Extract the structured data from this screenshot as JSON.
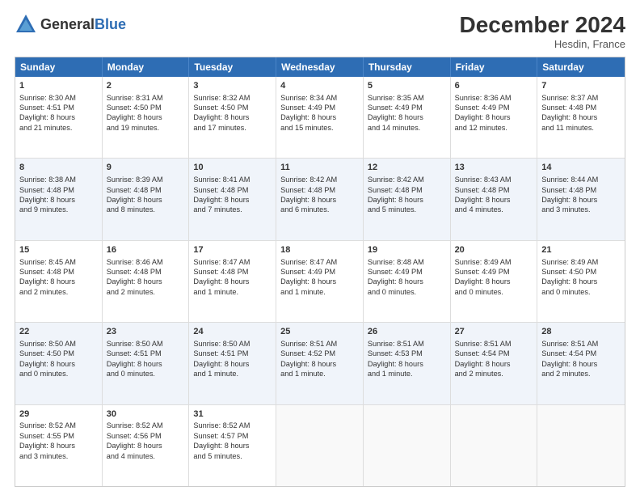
{
  "header": {
    "logo_general": "General",
    "logo_blue": "Blue",
    "title": "December 2024",
    "location": "Hesdin, France"
  },
  "days_of_week": [
    "Sunday",
    "Monday",
    "Tuesday",
    "Wednesday",
    "Thursday",
    "Friday",
    "Saturday"
  ],
  "rows": [
    [
      {
        "day": "1",
        "lines": [
          "Sunrise: 8:30 AM",
          "Sunset: 4:51 PM",
          "Daylight: 8 hours",
          "and 21 minutes."
        ]
      },
      {
        "day": "2",
        "lines": [
          "Sunrise: 8:31 AM",
          "Sunset: 4:50 PM",
          "Daylight: 8 hours",
          "and 19 minutes."
        ]
      },
      {
        "day": "3",
        "lines": [
          "Sunrise: 8:32 AM",
          "Sunset: 4:50 PM",
          "Daylight: 8 hours",
          "and 17 minutes."
        ]
      },
      {
        "day": "4",
        "lines": [
          "Sunrise: 8:34 AM",
          "Sunset: 4:49 PM",
          "Daylight: 8 hours",
          "and 15 minutes."
        ]
      },
      {
        "day": "5",
        "lines": [
          "Sunrise: 8:35 AM",
          "Sunset: 4:49 PM",
          "Daylight: 8 hours",
          "and 14 minutes."
        ]
      },
      {
        "day": "6",
        "lines": [
          "Sunrise: 8:36 AM",
          "Sunset: 4:49 PM",
          "Daylight: 8 hours",
          "and 12 minutes."
        ]
      },
      {
        "day": "7",
        "lines": [
          "Sunrise: 8:37 AM",
          "Sunset: 4:48 PM",
          "Daylight: 8 hours",
          "and 11 minutes."
        ]
      }
    ],
    [
      {
        "day": "8",
        "lines": [
          "Sunrise: 8:38 AM",
          "Sunset: 4:48 PM",
          "Daylight: 8 hours",
          "and 9 minutes."
        ]
      },
      {
        "day": "9",
        "lines": [
          "Sunrise: 8:39 AM",
          "Sunset: 4:48 PM",
          "Daylight: 8 hours",
          "and 8 minutes."
        ]
      },
      {
        "day": "10",
        "lines": [
          "Sunrise: 8:41 AM",
          "Sunset: 4:48 PM",
          "Daylight: 8 hours",
          "and 7 minutes."
        ]
      },
      {
        "day": "11",
        "lines": [
          "Sunrise: 8:42 AM",
          "Sunset: 4:48 PM",
          "Daylight: 8 hours",
          "and 6 minutes."
        ]
      },
      {
        "day": "12",
        "lines": [
          "Sunrise: 8:42 AM",
          "Sunset: 4:48 PM",
          "Daylight: 8 hours",
          "and 5 minutes."
        ]
      },
      {
        "day": "13",
        "lines": [
          "Sunrise: 8:43 AM",
          "Sunset: 4:48 PM",
          "Daylight: 8 hours",
          "and 4 minutes."
        ]
      },
      {
        "day": "14",
        "lines": [
          "Sunrise: 8:44 AM",
          "Sunset: 4:48 PM",
          "Daylight: 8 hours",
          "and 3 minutes."
        ]
      }
    ],
    [
      {
        "day": "15",
        "lines": [
          "Sunrise: 8:45 AM",
          "Sunset: 4:48 PM",
          "Daylight: 8 hours",
          "and 2 minutes."
        ]
      },
      {
        "day": "16",
        "lines": [
          "Sunrise: 8:46 AM",
          "Sunset: 4:48 PM",
          "Daylight: 8 hours",
          "and 2 minutes."
        ]
      },
      {
        "day": "17",
        "lines": [
          "Sunrise: 8:47 AM",
          "Sunset: 4:48 PM",
          "Daylight: 8 hours",
          "and 1 minute."
        ]
      },
      {
        "day": "18",
        "lines": [
          "Sunrise: 8:47 AM",
          "Sunset: 4:49 PM",
          "Daylight: 8 hours",
          "and 1 minute."
        ]
      },
      {
        "day": "19",
        "lines": [
          "Sunrise: 8:48 AM",
          "Sunset: 4:49 PM",
          "Daylight: 8 hours",
          "and 0 minutes."
        ]
      },
      {
        "day": "20",
        "lines": [
          "Sunrise: 8:49 AM",
          "Sunset: 4:49 PM",
          "Daylight: 8 hours",
          "and 0 minutes."
        ]
      },
      {
        "day": "21",
        "lines": [
          "Sunrise: 8:49 AM",
          "Sunset: 4:50 PM",
          "Daylight: 8 hours",
          "and 0 minutes."
        ]
      }
    ],
    [
      {
        "day": "22",
        "lines": [
          "Sunrise: 8:50 AM",
          "Sunset: 4:50 PM",
          "Daylight: 8 hours",
          "and 0 minutes."
        ]
      },
      {
        "day": "23",
        "lines": [
          "Sunrise: 8:50 AM",
          "Sunset: 4:51 PM",
          "Daylight: 8 hours",
          "and 0 minutes."
        ]
      },
      {
        "day": "24",
        "lines": [
          "Sunrise: 8:50 AM",
          "Sunset: 4:51 PM",
          "Daylight: 8 hours",
          "and 1 minute."
        ]
      },
      {
        "day": "25",
        "lines": [
          "Sunrise: 8:51 AM",
          "Sunset: 4:52 PM",
          "Daylight: 8 hours",
          "and 1 minute."
        ]
      },
      {
        "day": "26",
        "lines": [
          "Sunrise: 8:51 AM",
          "Sunset: 4:53 PM",
          "Daylight: 8 hours",
          "and 1 minute."
        ]
      },
      {
        "day": "27",
        "lines": [
          "Sunrise: 8:51 AM",
          "Sunset: 4:54 PM",
          "Daylight: 8 hours",
          "and 2 minutes."
        ]
      },
      {
        "day": "28",
        "lines": [
          "Sunrise: 8:51 AM",
          "Sunset: 4:54 PM",
          "Daylight: 8 hours",
          "and 2 minutes."
        ]
      }
    ],
    [
      {
        "day": "29",
        "lines": [
          "Sunrise: 8:52 AM",
          "Sunset: 4:55 PM",
          "Daylight: 8 hours",
          "and 3 minutes."
        ]
      },
      {
        "day": "30",
        "lines": [
          "Sunrise: 8:52 AM",
          "Sunset: 4:56 PM",
          "Daylight: 8 hours",
          "and 4 minutes."
        ]
      },
      {
        "day": "31",
        "lines": [
          "Sunrise: 8:52 AM",
          "Sunset: 4:57 PM",
          "Daylight: 8 hours",
          "and 5 minutes."
        ]
      },
      {
        "day": "",
        "lines": []
      },
      {
        "day": "",
        "lines": []
      },
      {
        "day": "",
        "lines": []
      },
      {
        "day": "",
        "lines": []
      }
    ]
  ]
}
